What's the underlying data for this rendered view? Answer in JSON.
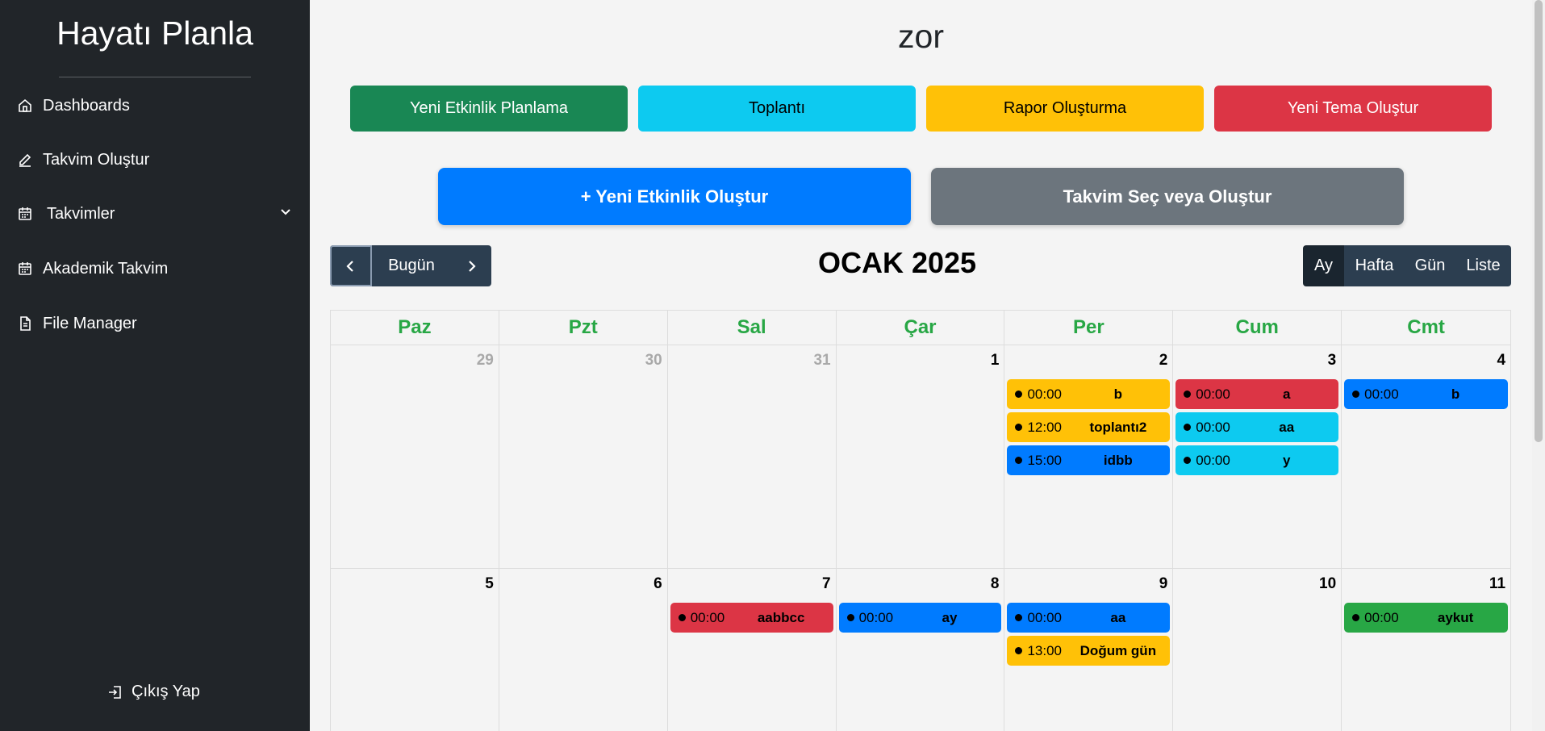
{
  "sidebar": {
    "brand": "Hayatı Planla",
    "items": [
      {
        "label": "Dashboards",
        "icon": "home-icon"
      },
      {
        "label": "Takvim Oluştur",
        "icon": "pencil-icon"
      },
      {
        "label": "Takvimler",
        "icon": "calendar-icon"
      },
      {
        "label": "Akademik Takvim",
        "icon": "calendar-icon"
      },
      {
        "label": "File Manager",
        "icon": "file-icon"
      }
    ],
    "logout": "Çıkış Yap"
  },
  "main": {
    "title": "zor",
    "quick_buttons": [
      {
        "label": "Yeni Etkinlik Planlama",
        "color": "#198754"
      },
      {
        "label": "Toplantı",
        "color": "#0dcaf0"
      },
      {
        "label": "Rapor Oluşturma",
        "color": "#ffc107"
      },
      {
        "label": "Yeni Tema Oluştur",
        "color": "#dc3545"
      }
    ],
    "new_event_button": "+ Yeni Etkinlik Oluştur",
    "select_calendar_button": "Takvim Seç veya Oluştur"
  },
  "calendar": {
    "title": "OCAK 2025",
    "today_label": "Bugün",
    "views": [
      "Ay",
      "Hafta",
      "Gün",
      "Liste"
    ],
    "active_view": "Ay",
    "weekdays": [
      "Paz",
      "Pzt",
      "Sal",
      "Çar",
      "Per",
      "Cum",
      "Cmt"
    ],
    "weeks": [
      [
        {
          "day": "29",
          "other": true,
          "events": []
        },
        {
          "day": "30",
          "other": true,
          "events": []
        },
        {
          "day": "31",
          "other": true,
          "events": []
        },
        {
          "day": "1",
          "events": []
        },
        {
          "day": "2",
          "events": [
            {
              "time": "00:00",
              "title": "b",
              "color": "#ffc107"
            },
            {
              "time": "12:00",
              "title": "toplantı2",
              "color": "#ffc107"
            },
            {
              "time": "15:00",
              "title": "idbb",
              "color": "#007bff"
            }
          ]
        },
        {
          "day": "3",
          "events": [
            {
              "time": "00:00",
              "title": "a",
              "color": "#dc3545"
            },
            {
              "time": "00:00",
              "title": "aa",
              "color": "#0dcaf0"
            },
            {
              "time": "00:00",
              "title": "y",
              "color": "#0dcaf0"
            }
          ]
        },
        {
          "day": "4",
          "events": [
            {
              "time": "00:00",
              "title": "b",
              "color": "#007bff"
            }
          ]
        }
      ],
      [
        {
          "day": "5",
          "events": []
        },
        {
          "day": "6",
          "events": []
        },
        {
          "day": "7",
          "events": [
            {
              "time": "00:00",
              "title": "aabbcc",
              "color": "#dc3545"
            }
          ]
        },
        {
          "day": "8",
          "events": [
            {
              "time": "00:00",
              "title": "ay",
              "color": "#007bff"
            }
          ]
        },
        {
          "day": "9",
          "events": [
            {
              "time": "00:00",
              "title": "aa",
              "color": "#007bff"
            },
            {
              "time": "13:00",
              "title": "Doğum gün",
              "color": "#ffc107"
            }
          ]
        },
        {
          "day": "10",
          "events": []
        },
        {
          "day": "11",
          "events": [
            {
              "time": "00:00",
              "title": "aykut",
              "color": "#28a745"
            }
          ]
        }
      ]
    ]
  }
}
